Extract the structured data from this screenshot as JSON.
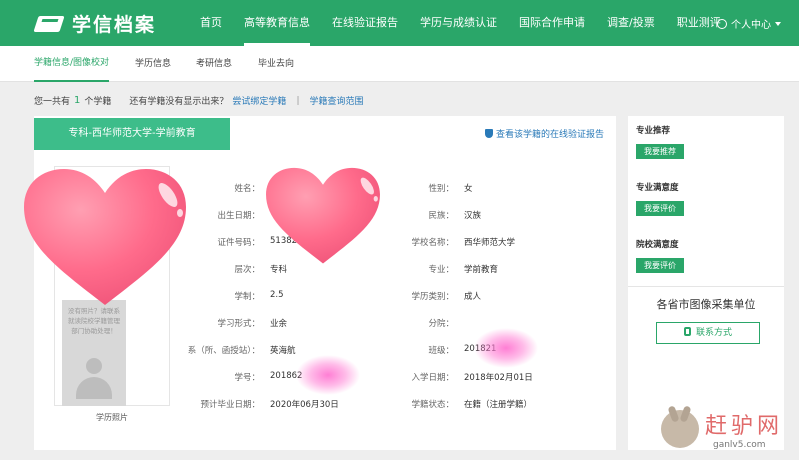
{
  "header": {
    "logo_text": "学信档案",
    "nav": [
      {
        "label": "首页",
        "active": false
      },
      {
        "label": "高等教育信息",
        "active": true
      },
      {
        "label": "在线验证报告",
        "active": false
      },
      {
        "label": "学历与成绩认证",
        "active": false
      },
      {
        "label": "国际合作申请",
        "active": false
      },
      {
        "label": "调查/投票",
        "active": false
      },
      {
        "label": "职业测评",
        "active": false
      }
    ],
    "user_center": "个人中心"
  },
  "subnav": {
    "tabs": [
      {
        "label": "学籍信息/图像校对",
        "active": true
      },
      {
        "label": "学历信息",
        "active": false
      },
      {
        "label": "考研信息",
        "active": false
      },
      {
        "label": "毕业去向",
        "active": false
      }
    ]
  },
  "summary": {
    "prefix": "您一共有",
    "count": "1",
    "suffix": "个学籍",
    "question": "还有学籍没有显示出来？",
    "bind_link": "尝试绑定学籍",
    "separator": "|",
    "scope_link": "学籍查询范围"
  },
  "card": {
    "school_tag": "专科-西华师范大学-学前教育",
    "verify_link": "查看该学籍的在线验证报告",
    "photo": {
      "hint": "没有照片？请联系就读院校学籍管理部门协助处理！",
      "label": "学历照片"
    },
    "left_fields": [
      {
        "label": "姓名：",
        "value": ""
      },
      {
        "label": "出生日期：",
        "value": ""
      },
      {
        "label": "证件号码：",
        "value": "51382"
      },
      {
        "label": "层次：",
        "value": "专科"
      },
      {
        "label": "学制：",
        "value": "2.5"
      },
      {
        "label": "学习形式：",
        "value": "业余"
      },
      {
        "label": "系（所、函授站）：",
        "value": "英海航"
      },
      {
        "label": "学号：",
        "value": "201862"
      },
      {
        "label": "预计毕业日期：",
        "value": "2020年06月30日"
      }
    ],
    "right_fields": [
      {
        "label": "性别：",
        "value": "女"
      },
      {
        "label": "民族：",
        "value": "汉族"
      },
      {
        "label": "学校名称：",
        "value": "西华师范大学"
      },
      {
        "label": "专业：",
        "value": "学前教育"
      },
      {
        "label": "学历类别：",
        "value": "成人"
      },
      {
        "label": "分院：",
        "value": ""
      },
      {
        "label": "班级：",
        "value": "201821"
      },
      {
        "label": "入学日期：",
        "value": "2018年02月01日"
      },
      {
        "label": "学籍状态：",
        "value": "在籍（注册学籍）"
      }
    ]
  },
  "sidebar": {
    "blocks": [
      {
        "title": "专业推荐",
        "button": "我要推荐"
      },
      {
        "title": "专业满意度",
        "button": "我要评价"
      },
      {
        "title": "院校满意度",
        "button": "我要评价"
      }
    ],
    "image_units_title": "各省市图像采集单位",
    "contact_button": "联系方式"
  },
  "watermark": {
    "title": "赶驴网",
    "site": "ganlv5.com"
  },
  "colors": {
    "brand": "#2aa669",
    "link": "#2a7ab8",
    "heart": "#ff6b8b",
    "blur": "#ff78d2"
  }
}
